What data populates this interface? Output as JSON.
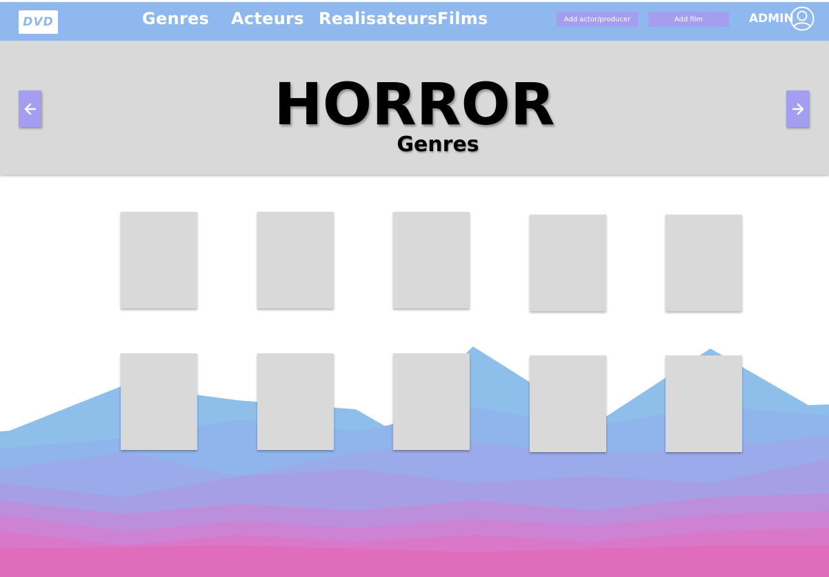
{
  "navbar": {
    "logo_text": "DVD",
    "links": [
      "Genres",
      "Acteurs",
      "Realisateurs",
      "Films"
    ],
    "add_actor_label": "Add actor/producer",
    "add_film_label": "Add film",
    "user_label": "ADMIN",
    "user_icon": "user-circle-icon"
  },
  "banner": {
    "title": "HORROR",
    "subtitle": "Genres",
    "prev_icon": "arrow-left-icon",
    "next_icon": "arrow-right-icon"
  },
  "films": {
    "rows": 2,
    "columns": 5,
    "poster_count": 10
  },
  "colors": {
    "navbar": "#8fb8ee",
    "accent": "#a39ef0",
    "banner": "#d9d9d9",
    "poster": "#d9d9d9",
    "mountain_blue": "#8ebfea",
    "mountain_pink": "#e06dbc"
  }
}
